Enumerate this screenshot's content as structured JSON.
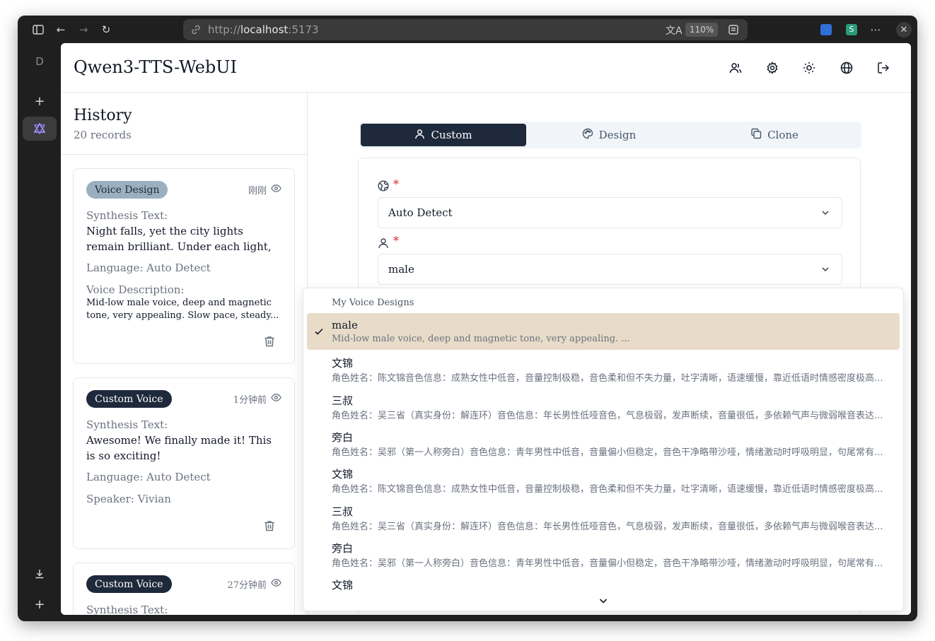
{
  "browser": {
    "url_scheme": "http://",
    "url_host": "localhost",
    "url_port": ":5173",
    "zoom": "110%",
    "sidebar_letter": "D"
  },
  "app": {
    "title": "Qwen3-TTS-WebUI"
  },
  "history": {
    "title": "History",
    "count": "20 records",
    "cards": [
      {
        "type": "Voice Design",
        "time": "刚刚",
        "synthesis_label": "Synthesis Text:",
        "synthesis_text": "Night falls, yet the city lights remain brilliant. Under each light, there's a...",
        "language": "Language: Auto Detect",
        "desc_label": "Voice Description:",
        "desc_text": "Mid-low male voice, deep and magnetic tone, very appealing. Slow pace, steady..."
      },
      {
        "type": "Custom Voice",
        "time": "1分钟前",
        "synthesis_label": "Synthesis Text:",
        "synthesis_text": "Awesome! We finally made it! This is so exciting!",
        "language": "Language: Auto Detect",
        "speaker": "Speaker: Vivian"
      },
      {
        "type": "Custom Voice",
        "time": "27分钟前",
        "synthesis_label": "Synthesis Text:"
      }
    ]
  },
  "tabs": {
    "custom": "Custom",
    "design": "Design",
    "clone": "Clone"
  },
  "form": {
    "language_value": "Auto Detect",
    "voice_value": "male",
    "required_mark": "*"
  },
  "dropdown": {
    "group_label": "My Voice Designs",
    "items": [
      {
        "name": "male",
        "desc": "Mid-low male voice, deep and magnetic tone, very appealing. ..."
      },
      {
        "name": "文锦",
        "desc": "角色姓名：陈文锦音色信息：成熟女性中低音，音量控制极稳，音色柔和但不失力量，吐字清晰，语速缓慢，靠近低语时情感密度极高..."
      },
      {
        "name": "三叔",
        "desc": "角色姓名：吴三省（真实身份：解连环）音色信息：年长男性低哑音色，气息极弱，发声断续，音量很低，多依赖气声与微弱喉音表达..."
      },
      {
        "name": "旁白",
        "desc": "角色姓名：吴邪（第一人称旁白）音色信息：青年男性中低音，音量偏小但稳定，音色干净略带沙哑，情绪激动时呼吸明显，句尾常有..."
      },
      {
        "name": "文锦",
        "desc": "角色姓名：陈文锦音色信息：成熟女性中低音，音量控制极稳，音色柔和但不失力量，吐字清晰，语速缓慢，靠近低语时情感密度极高..."
      },
      {
        "name": "三叔",
        "desc": "角色姓名：吴三省（真实身份：解连环）音色信息：年长男性低哑音色，气息极弱，发声断续，音量很低，多依赖气声与微弱喉音表达..."
      },
      {
        "name": "旁白",
        "desc": "角色姓名：吴邪（第一人称旁白）音色信息：青年男性中低音，音量偏小但稳定，音色干净略带沙哑，情绪激动时呼吸明显，句尾常有..."
      },
      {
        "name": "文锦",
        "desc": ""
      }
    ]
  }
}
